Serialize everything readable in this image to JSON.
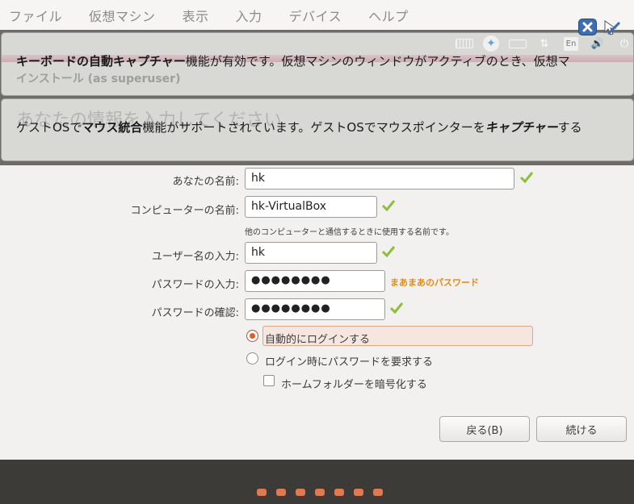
{
  "menubar": {
    "items": [
      "ファイル",
      "仮想マシン",
      "表示",
      "入力",
      "デバイス",
      "ヘルプ"
    ]
  },
  "banner_keyboard": {
    "pre": "",
    "bold": "キーボードの自動キャプチャー",
    "post": "機能が有効です。仮想マシンのウィンドウがアクティブのとき、仮想マ",
    "underlying": "インストール (as superuser)"
  },
  "banner_mouse": {
    "pre": "ゲストOSで",
    "bold": "マウス統合",
    "mid": "機能がサポートされています。ゲストOSでマウスポインターを",
    "italic": "キャプチャー",
    "post": "する",
    "underlying": "あなたの情報を入力してください"
  },
  "tray": {
    "lang": "En",
    "volume": "🔊",
    "network": "⇅",
    "power": "⏻"
  },
  "form": {
    "name_label": "あなたの名前:",
    "name_value": "hk",
    "computer_label": "コンピューターの名前:",
    "computer_value": "hk-VirtualBox",
    "computer_hint": "他のコンピューターと通信するときに使用する名前です。",
    "username_label": "ユーザー名の入力:",
    "username_value": "hk",
    "password_label": "パスワードの入力:",
    "password_value": "●●●●●●●●",
    "password_strength": "まあまあのパスワード",
    "confirm_label": "パスワードの確認:",
    "confirm_value": "●●●●●●●●",
    "autologin_label": "自動的にログインする",
    "require_password_label": "ログイン時にパスワードを要求する",
    "encrypt_home_label": "ホームフォルダーを暗号化する"
  },
  "buttons": {
    "back": "戻る(B)",
    "continue": "続ける"
  },
  "colors": {
    "accent": "#e05d2a",
    "strength": "#e48a16",
    "check": "#8cbf3a",
    "bottom_bar": "#3c3b37",
    "progress_dot": "#e07a52"
  },
  "progress": {
    "total_steps": 7
  }
}
